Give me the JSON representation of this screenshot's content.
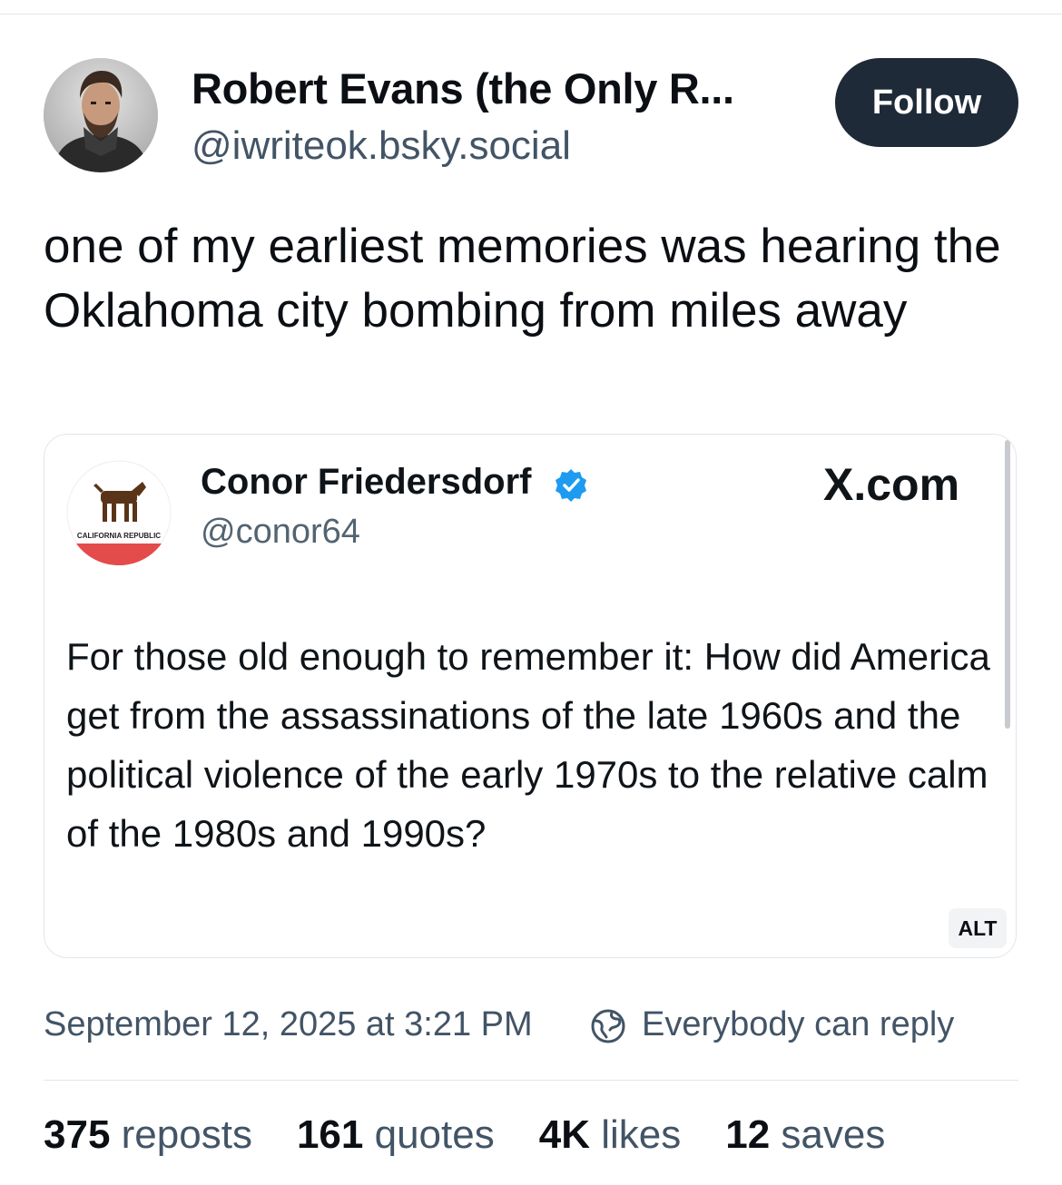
{
  "author": {
    "display_name": "Robert Evans (the Only R...",
    "handle": "@iwriteok.bsky.social",
    "avatar_icon": "avatar-photo-icon"
  },
  "follow_label": "Follow",
  "post_text": "one of my earliest memories was hearing the Oklahoma city bombing from miles away",
  "embed": {
    "name": "Conor Friedersdorf",
    "handle": "@conor64",
    "source": "X.com",
    "avatar_text": "CALIFORNIA REPUBLIC",
    "text": "For those old enough to remember it: How did America get from the assassinations of the late 1960s and the political violence of the early 1970s to the relative calm of the 1980s and 1990s?",
    "alt_label": "ALT",
    "verified_color": "#1d9bf0"
  },
  "meta": {
    "timestamp": "September 12, 2025 at 3:21 PM",
    "reply_setting": "Everybody can reply"
  },
  "stats": [
    {
      "count": "375",
      "label": "reposts"
    },
    {
      "count": "161",
      "label": "quotes"
    },
    {
      "count": "4K",
      "label": "likes"
    },
    {
      "count": "12",
      "label": "saves"
    }
  ],
  "colors": {
    "follow_bg": "#1f2a38",
    "secondary_text": "#425466"
  }
}
